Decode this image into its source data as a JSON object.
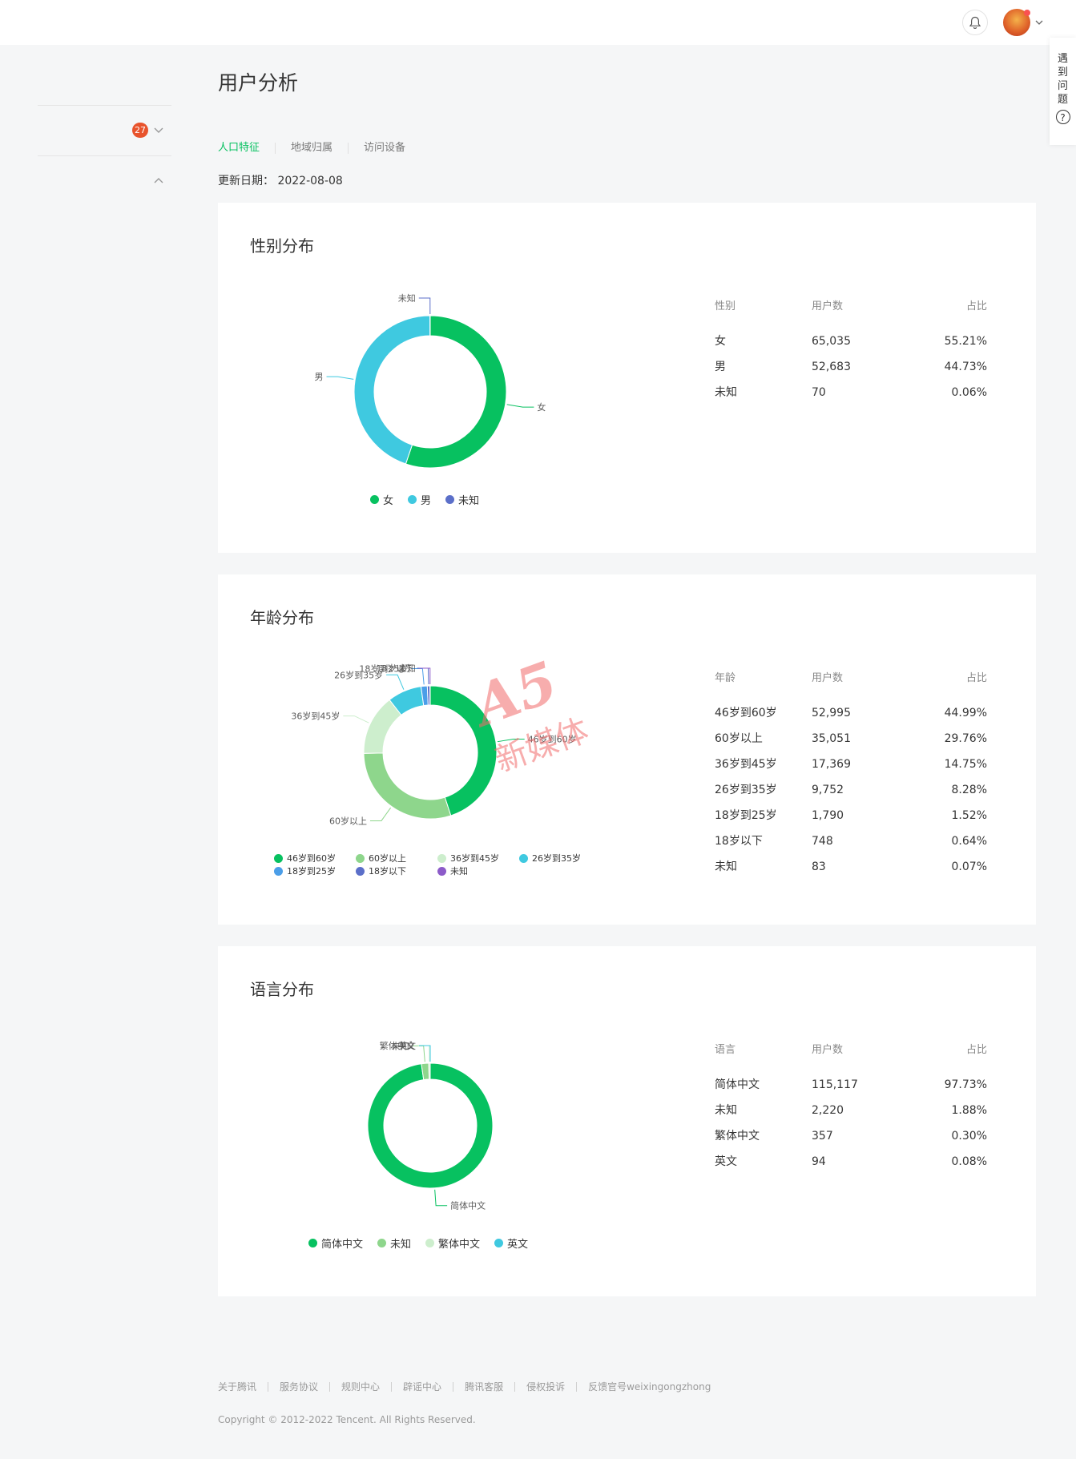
{
  "header": {
    "bell_icon": "bell-icon",
    "avatar_icon": "avatar-image",
    "dropdown_icon": "chevron-down-icon"
  },
  "help_panel": {
    "text": "遇到问题",
    "icon": "question-icon",
    "icon_glyph": "?"
  },
  "sidebar": {
    "badge_count": "27"
  },
  "page": {
    "title": "用户分析",
    "tabs": [
      {
        "label": "人口特征",
        "active": true
      },
      {
        "label": "地域归属",
        "active": false
      },
      {
        "label": "访问设备",
        "active": false
      }
    ],
    "update_label": "更新日期：",
    "update_date": "2022-08-08"
  },
  "gender": {
    "title": "性别分布",
    "headers": [
      "性别",
      "用户数",
      "占比"
    ],
    "rows": [
      [
        "女",
        "65,035",
        "55.21%"
      ],
      [
        "男",
        "52,683",
        "44.73%"
      ],
      [
        "未知",
        "70",
        "0.06%"
      ]
    ],
    "legend": [
      "女",
      "男",
      "未知"
    ]
  },
  "age": {
    "title": "年龄分布",
    "headers": [
      "年龄",
      "用户数",
      "占比"
    ],
    "rows": [
      [
        "46岁到60岁",
        "52,995",
        "44.99%"
      ],
      [
        "60岁以上",
        "35,051",
        "29.76%"
      ],
      [
        "36岁到45岁",
        "17,369",
        "14.75%"
      ],
      [
        "26岁到35岁",
        "9,752",
        "8.28%"
      ],
      [
        "18岁到25岁",
        "1,790",
        "1.52%"
      ],
      [
        "18岁以下",
        "748",
        "0.64%"
      ],
      [
        "未知",
        "83",
        "0.07%"
      ]
    ],
    "legend": [
      "46岁到60岁",
      "60岁以上",
      "36岁到45岁",
      "26岁到35岁",
      "18岁到25岁",
      "18岁以下",
      "未知"
    ]
  },
  "language": {
    "title": "语言分布",
    "headers": [
      "语言",
      "用户数",
      "占比"
    ],
    "rows": [
      [
        "简体中文",
        "115,117",
        "97.73%"
      ],
      [
        "未知",
        "2,220",
        "1.88%"
      ],
      [
        "繁体中文",
        "357",
        "0.30%"
      ],
      [
        "英文",
        "94",
        "0.08%"
      ]
    ],
    "legend": [
      "简体中文",
      "未知",
      "繁体中文",
      "英文"
    ]
  },
  "chart_data": [
    {
      "type": "pie",
      "title": "性别分布",
      "categories": [
        "女",
        "男",
        "未知"
      ],
      "values": [
        65035,
        52683,
        70
      ],
      "colors": [
        "#07c160",
        "#3fc9e0",
        "#5b6fc9"
      ]
    },
    {
      "type": "pie",
      "title": "年龄分布",
      "categories": [
        "46岁到60岁",
        "60岁以上",
        "36岁到45岁",
        "26岁到35岁",
        "18岁到25岁",
        "18岁以下",
        "未知"
      ],
      "values": [
        52995,
        35051,
        17369,
        9752,
        1790,
        748,
        83
      ],
      "colors": [
        "#07c160",
        "#8ed68c",
        "#cdeecd",
        "#3fc9e0",
        "#4b9ee8",
        "#5b6fc9",
        "#8c5bc9"
      ]
    },
    {
      "type": "pie",
      "title": "语言分布",
      "categories": [
        "简体中文",
        "未知",
        "繁体中文",
        "英文"
      ],
      "values": [
        115117,
        2220,
        357,
        94
      ],
      "colors": [
        "#07c160",
        "#8ed68c",
        "#cdeecd",
        "#3fc9e0"
      ]
    }
  ],
  "watermark": {
    "line1": "A5",
    "line2": "新媒体"
  },
  "footer": {
    "links": [
      "关于腾讯",
      "服务协议",
      "规则中心",
      "辟谣中心",
      "腾讯客服",
      "侵权投诉",
      "反馈官号weixingongzhong"
    ],
    "copyright": "Copyright © 2012-2022 Tencent. All Rights Reserved."
  }
}
